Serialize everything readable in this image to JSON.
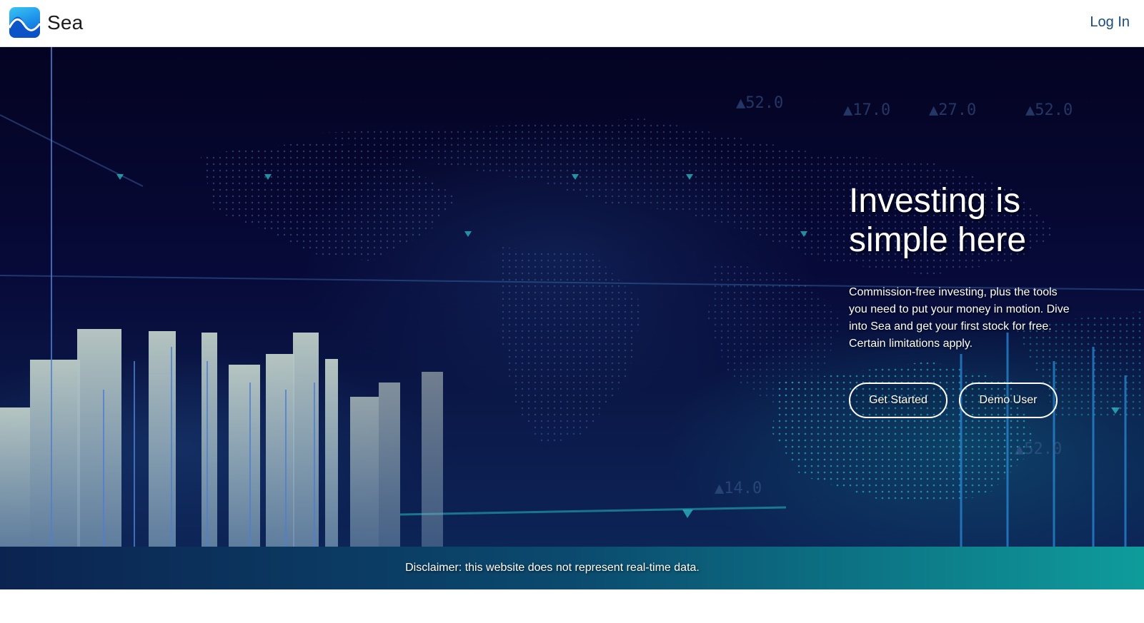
{
  "navbar": {
    "brand": "Sea",
    "login_label": "Log In"
  },
  "hero": {
    "title": "Investing is simple here",
    "subtitle": "Commission-free investing, plus the tools you need to put your money in motion. Dive into Sea and get your first stock for free. Certain limitations apply.",
    "get_started_label": "Get Started",
    "demo_user_label": "Demo User"
  },
  "disclaimer": {
    "text": "Disclaimer: this website does not represent real-time data."
  },
  "colors": {
    "login_link": "#184a84",
    "hero_dark": "#040322",
    "banner_left": "#0b2350",
    "banner_right": "#0e9c9b"
  },
  "icons": {
    "logo": "wave-icon"
  }
}
